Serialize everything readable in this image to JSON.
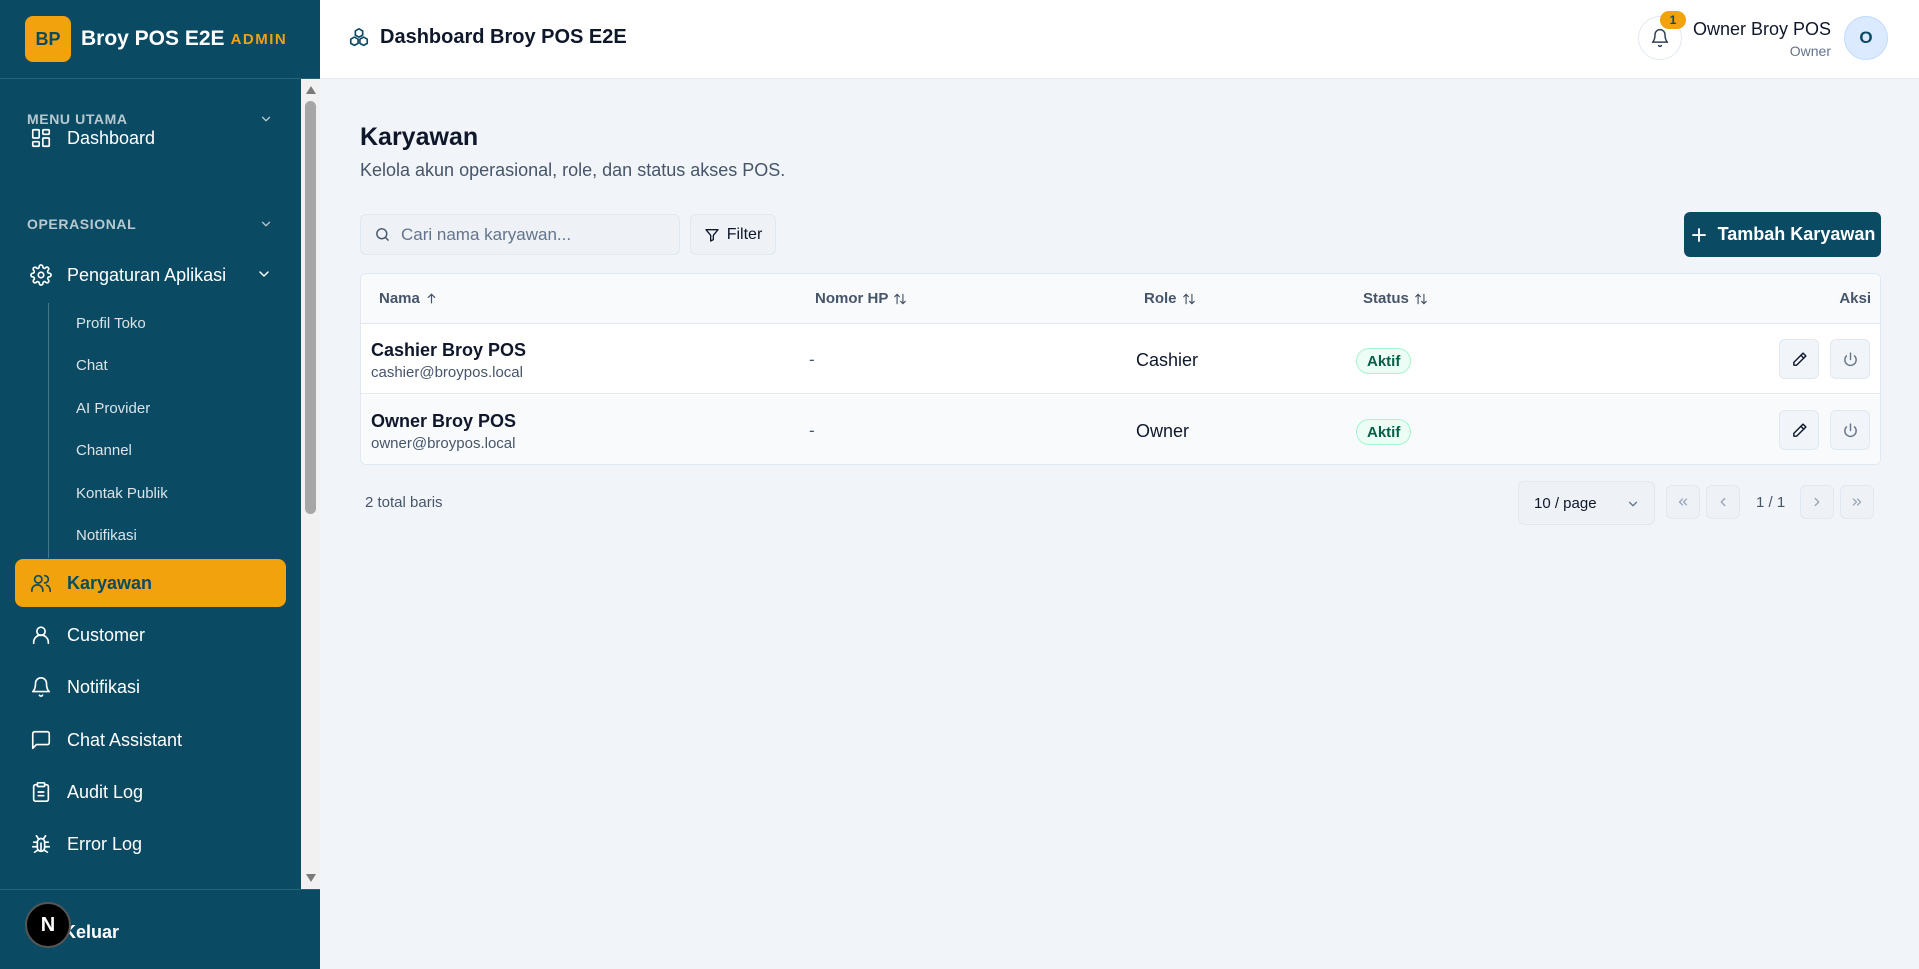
{
  "brand": {
    "logo": "BP",
    "name": "Broy POS E2E",
    "badge": "ADMIN"
  },
  "sidebar": {
    "sections": [
      {
        "label": "MENU UTAMA",
        "icon": "chevron-down-icon"
      },
      {
        "label": "OPERASIONAL",
        "icon": "chevron-down-icon"
      }
    ],
    "items": [
      {
        "label": "Dashboard",
        "icon": "dashboard-icon"
      },
      {
        "label": "Pengaturan Aplikasi",
        "icon": "gear-icon"
      },
      {
        "label": "Karyawan",
        "icon": "users-icon",
        "active": true
      },
      {
        "label": "Customer",
        "icon": "user-icon"
      },
      {
        "label": "Notifikasi",
        "icon": "bell-icon"
      },
      {
        "label": "Chat Assistant",
        "icon": "chat-icon"
      },
      {
        "label": "Audit Log",
        "icon": "clipboard-icon"
      },
      {
        "label": "Error Log",
        "icon": "bug-icon"
      }
    ],
    "subitems": [
      "Profil Toko",
      "Chat",
      "AI Provider",
      "Channel",
      "Kontak Publik",
      "Notifikasi"
    ],
    "logout": "Keluar",
    "n_badge": "N"
  },
  "header": {
    "title": "Dashboard Broy POS E2E",
    "notification_count": "1",
    "user_name": "Owner Broy POS",
    "user_role": "Owner",
    "avatar": "O"
  },
  "main": {
    "title": "Karyawan",
    "subtitle": "Kelola akun operasional, role, dan status akses POS.",
    "search_placeholder": "Cari nama karyawan...",
    "filter_label": "Filter",
    "add_label": "Tambah Karyawan",
    "columns": [
      "Nama",
      "Nomor HP",
      "Role",
      "Status",
      "Aksi"
    ],
    "rows": [
      {
        "name": "Cashier Broy POS",
        "email": "cashier@broypos.local",
        "phone": "-",
        "role": "Cashier",
        "status": "Aktif"
      },
      {
        "name": "Owner Broy POS",
        "email": "owner@broypos.local",
        "phone": "-",
        "role": "Owner",
        "status": "Aktif"
      }
    ],
    "total": "2 total baris",
    "page_size": "10 / page",
    "page_label": "1 / 1"
  },
  "colors": {
    "sidebar": "#0b4a63",
    "accent": "#f2a20c",
    "success": "#065f46"
  }
}
